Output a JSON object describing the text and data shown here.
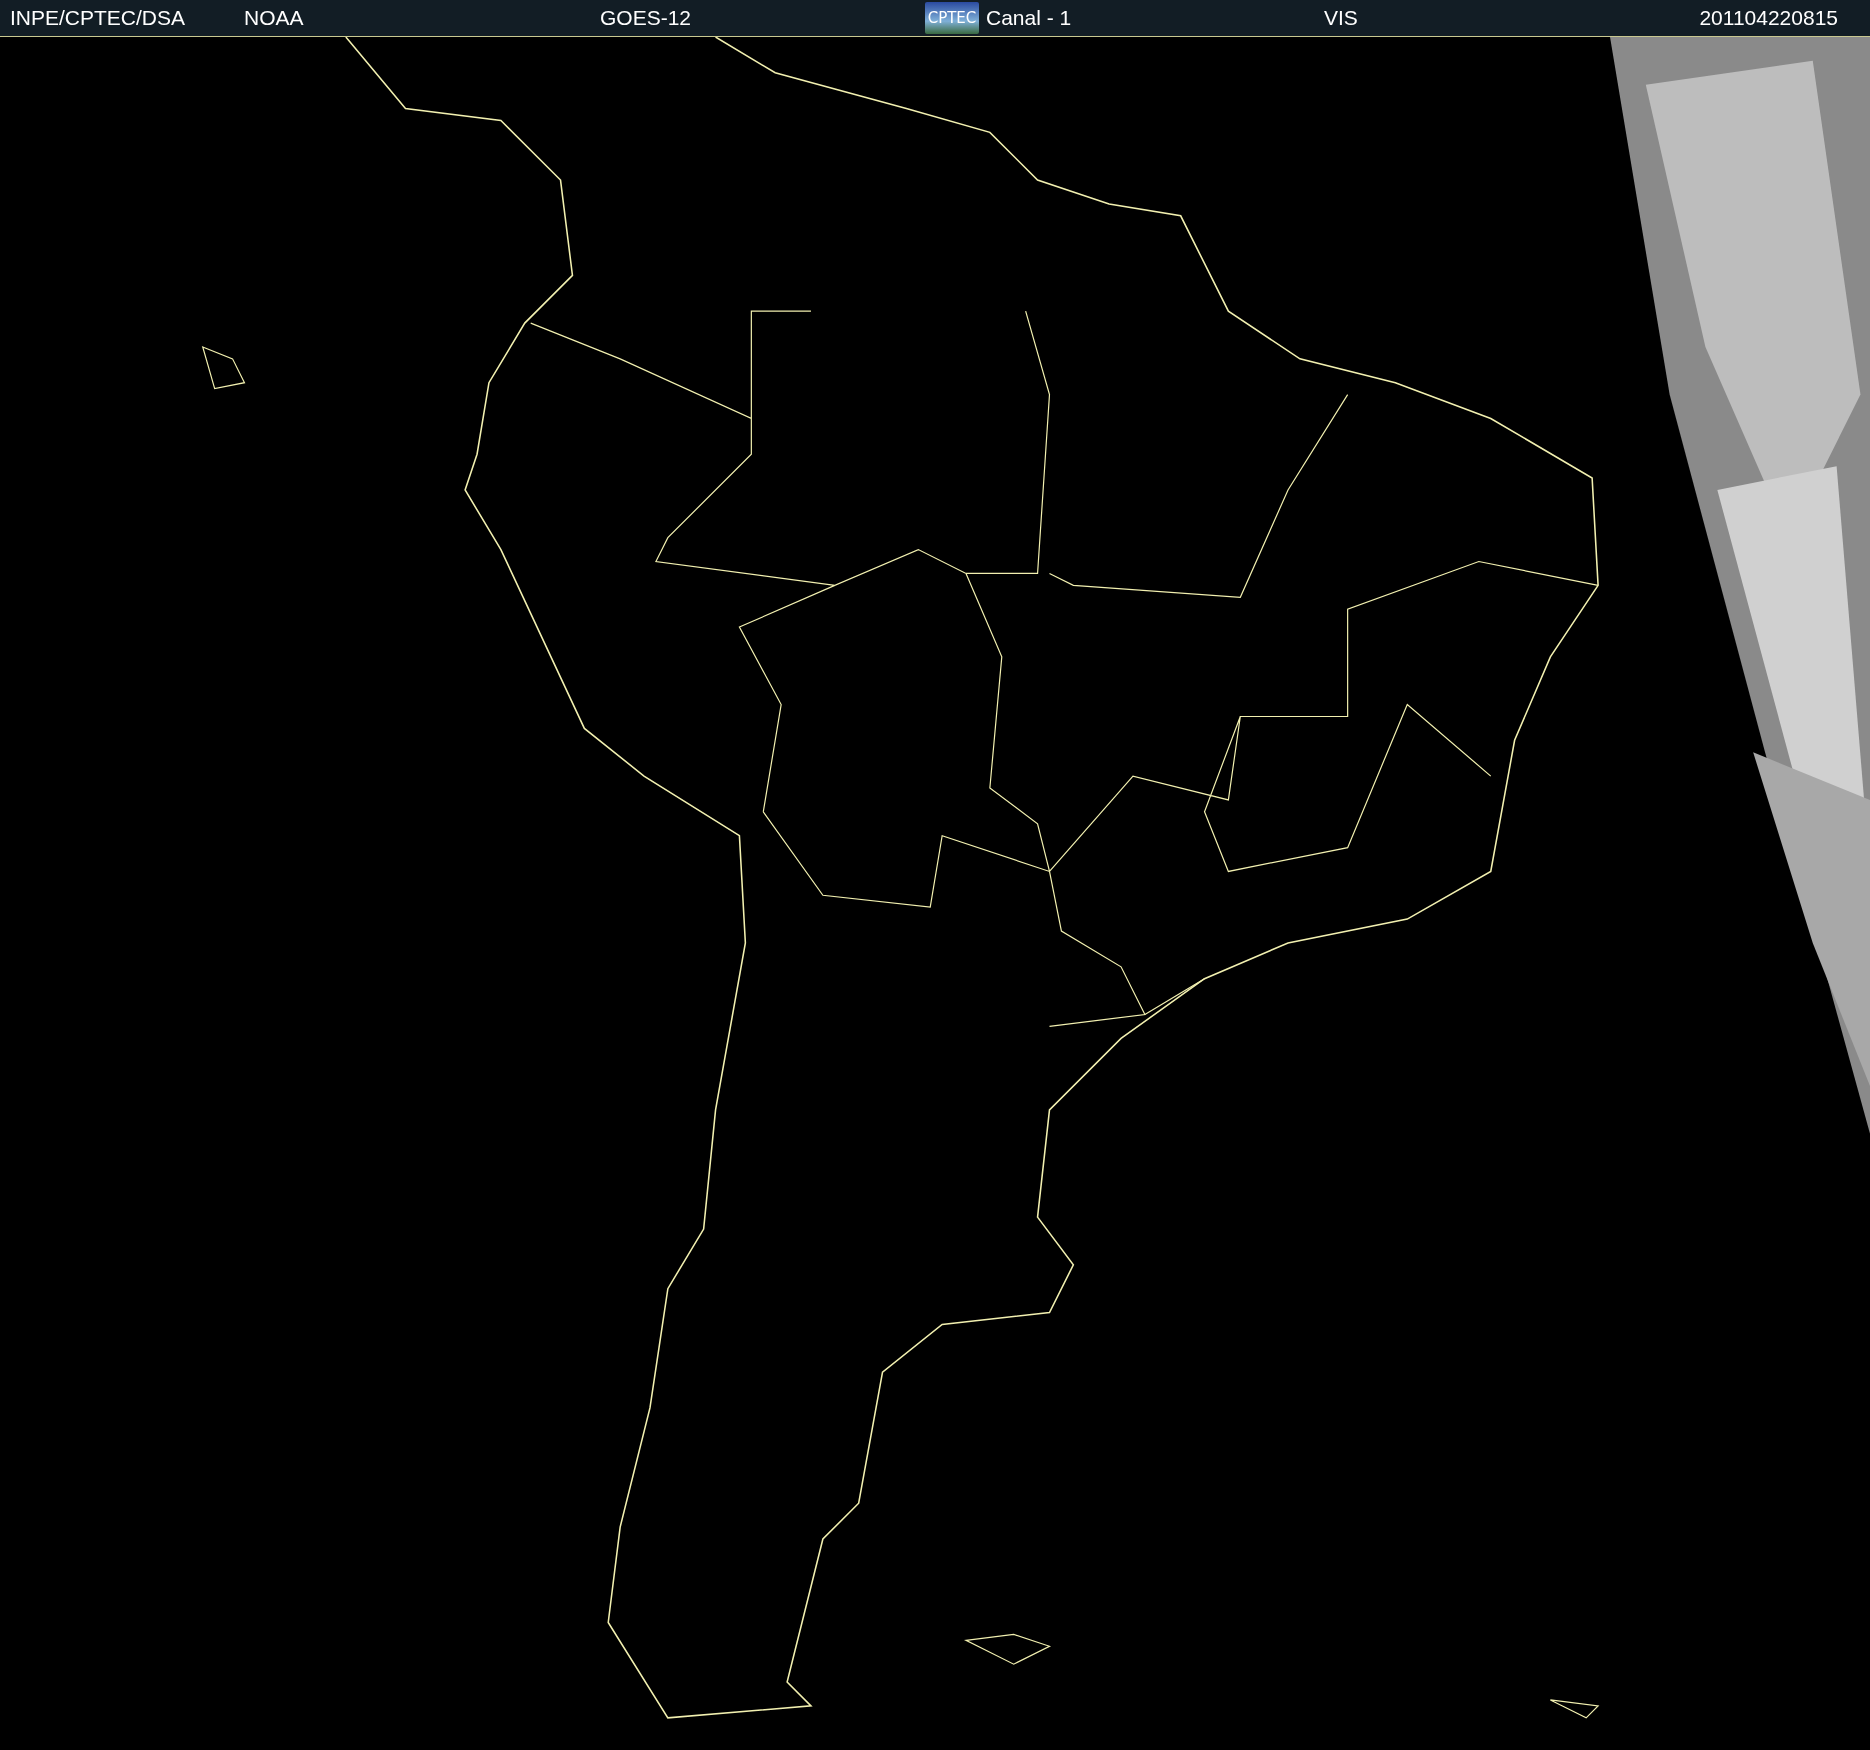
{
  "header": {
    "source": "INPE/CPTEC/DSA",
    "agency": "NOAA",
    "satellite": "GOES-12",
    "logo": "CPTEC",
    "channel": "Canal - 1",
    "band": "VIS",
    "timestamp": "201104220815"
  }
}
